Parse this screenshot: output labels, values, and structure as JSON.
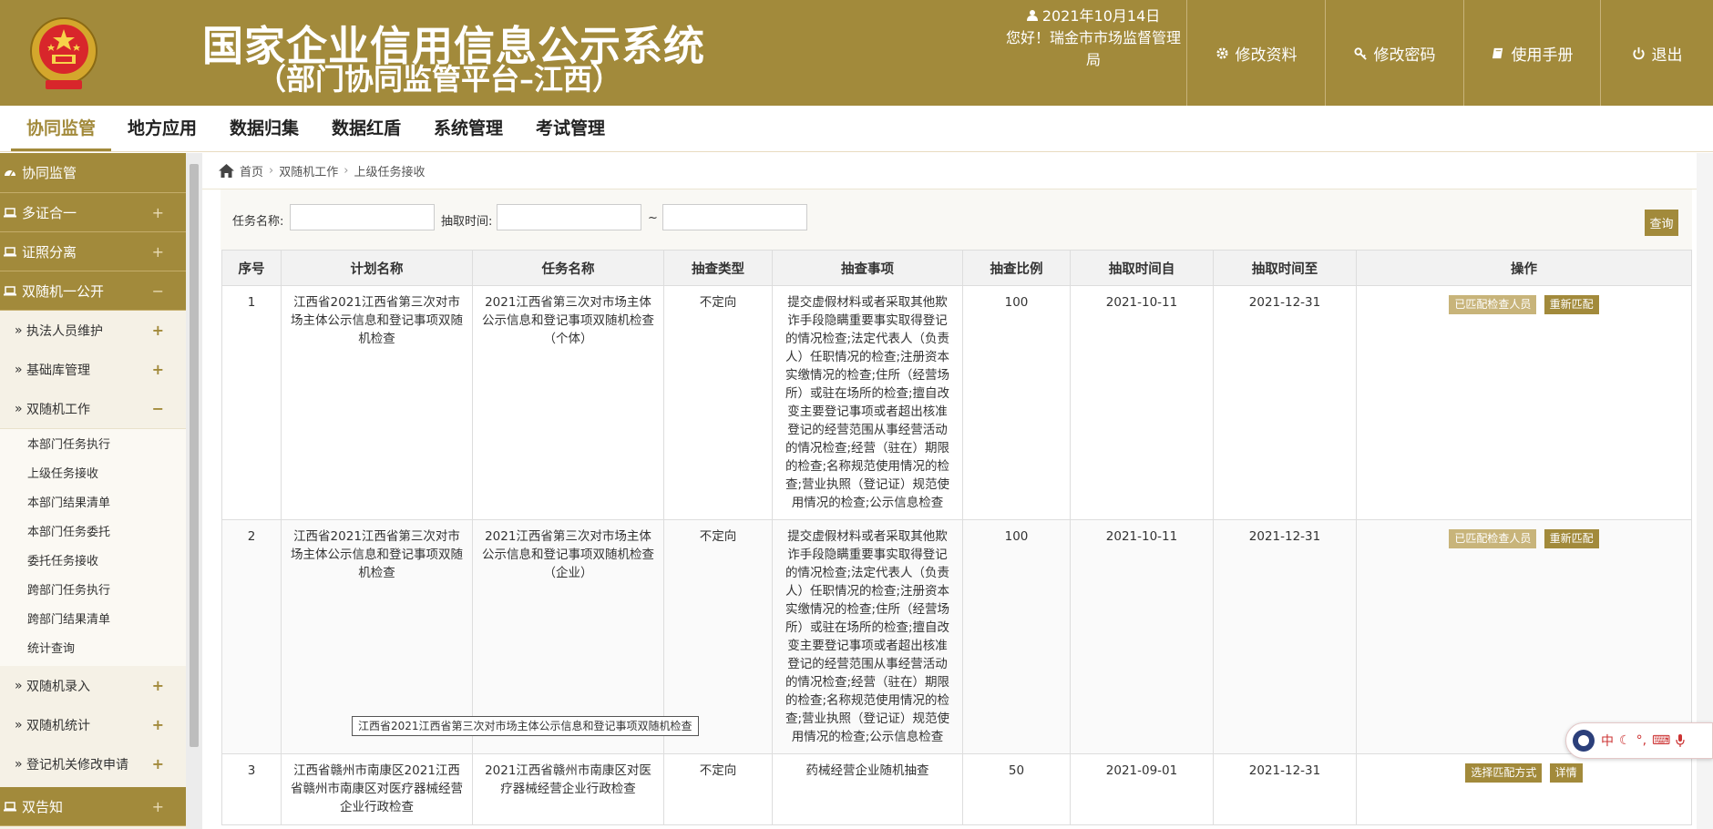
{
  "header": {
    "title": "国家企业信用信息公示系统",
    "subtitle": "（部门协同监管平台–江西）",
    "date": "2021年10月14日",
    "greeting": "您好！瑞金市市场监督管理局",
    "buttons": [
      "修改资料",
      "修改密码",
      "使用手册",
      "退出"
    ]
  },
  "topnav": [
    "协同监管",
    "地方应用",
    "数据归集",
    "数据红盾",
    "系统管理",
    "考试管理"
  ],
  "sidebar": {
    "top": "协同监管",
    "groups": [
      "多证合一",
      "证照分离",
      "双随机一公开"
    ],
    "subs_before": [
      "执法人员维护",
      "基础库管理",
      "双随机工作"
    ],
    "leaves": [
      "本部门任务执行",
      "上级任务接收",
      "本部门结果清单",
      "本部门任务委托",
      "委托任务接收",
      "跨部门任务执行",
      "跨部门结果清单",
      "统计查询"
    ],
    "subs_after": [
      "双随机录入",
      "双随机统计",
      "登记机关修改申请"
    ],
    "bottom": "双告知",
    "plus": "+",
    "minus": "−"
  },
  "breadcrumb": [
    "首页",
    "双随机工作",
    "上级任务接收"
  ],
  "search": {
    "task_name_label": "任务名称:",
    "time_label": "抽取时间:",
    "tilde": "~",
    "query_button": "查询"
  },
  "table": {
    "headers": [
      "序号",
      "计划名称",
      "任务名称",
      "抽查类型",
      "抽查事项",
      "抽查比例",
      "抽取时间自",
      "抽取时间至",
      "操作"
    ],
    "rows": [
      {
        "no": "1",
        "plan": "江西省2021江西省第三次对市场主体公示信息和登记事项双随机检查",
        "task": "2021江西省第三次对市场主体公示信息和登记事项双随机检查（个体）",
        "type": "不定向",
        "items": "提交虚假材料或者采取其他欺诈手段隐瞒重要事实取得登记的情况检查;法定代表人（负责人）任职情况的检查;注册资本实缴情况的检查;住所（经营场所）或驻在场所的检查;擅自改变主要登记事项或者超出核准登记的经营范围从事经营活动的情况检查;经营（驻在）期限的检查;名称规范使用情况的检查;营业执照（登记证）规范使用情况的检查;公示信息检查",
        "ratio": "100",
        "from": "2021-10-11",
        "to": "2021-12-31",
        "actions": [
          "已匹配检查人员",
          "重新匹配"
        ]
      },
      {
        "no": "2",
        "plan": "江西省2021江西省第三次对市场主体公示信息和登记事项双随机检查",
        "task": "2021江西省第三次对市场主体公示信息和登记事项双随机检查（企业）",
        "type": "不定向",
        "items": "提交虚假材料或者采取其他欺诈手段隐瞒重要事实取得登记的情况检查;法定代表人（负责人）任职情况的检查;注册资本实缴情况的检查;住所（经营场所）或驻在场所的检查;擅自改变主要登记事项或者超出核准登记的经营范围从事经营活动的情况检查;经营（驻在）期限的检查;名称规范使用情况的检查;营业执照（登记证）规范使用情况的检查;公示信息检查",
        "ratio": "100",
        "from": "2021-10-11",
        "to": "2021-12-31",
        "actions": [
          "已匹配检查人员",
          "重新匹配"
        ]
      },
      {
        "no": "3",
        "plan": "江西省赣州市南康区2021江西省赣州市南康区对医疗器械经营企业行政检查",
        "task": "2021江西省赣州市南康区对医疗器械经营企业行政检查",
        "type": "不定向",
        "items": "药械经营企业随机抽查",
        "ratio": "50",
        "from": "2021-09-01",
        "to": "2021-12-31",
        "actions": [
          "选择匹配方式",
          "详情"
        ]
      }
    ]
  },
  "tooltip": "江西省2021江西省第三次对市场主体公示信息和登记事项双随机检查",
  "ime": {
    "label": "中"
  },
  "colors": {
    "brand": "#a28a3b",
    "brand_light": "#c8b47a",
    "sidebar_bg": "#f5f1e6"
  }
}
